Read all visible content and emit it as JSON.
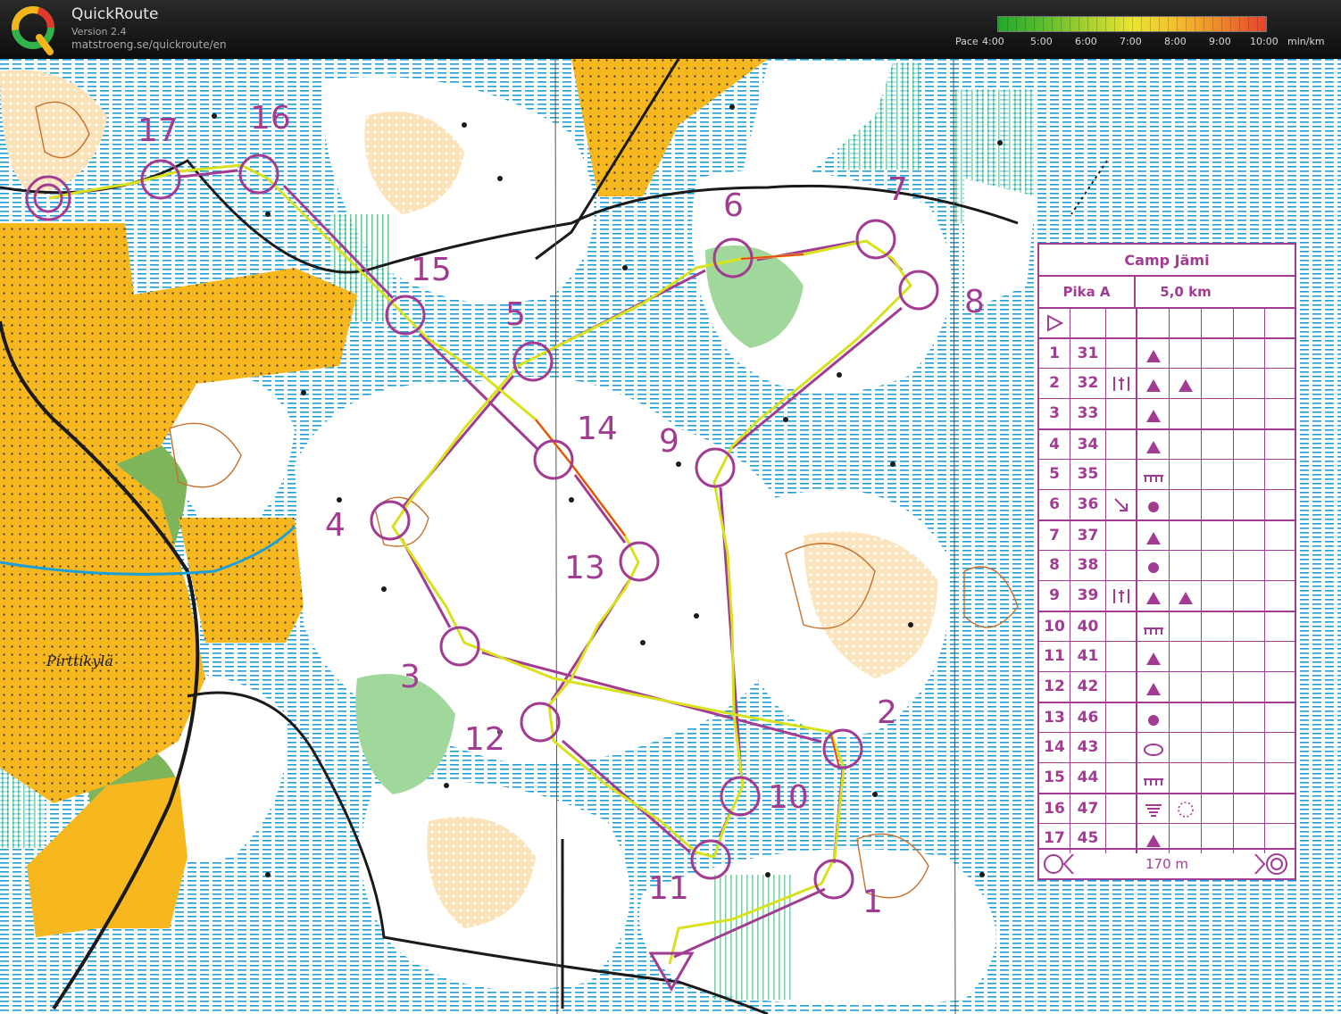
{
  "app": {
    "name": "QuickRoute",
    "version": "Version 2.4",
    "url": "matstroeng.se/quickroute/en"
  },
  "pace_scale": {
    "label": "Pace",
    "ticks": [
      "4:00",
      "5:00",
      "6:00",
      "7:00",
      "8:00",
      "9:00",
      "10:00"
    ],
    "unit": "min/km",
    "colors": [
      "#1faa2a",
      "#e9e52e",
      "#e8422a"
    ]
  },
  "map": {
    "place_name": "Pirttikylä",
    "colors": {
      "open_land": "#f7b71f",
      "marsh_blue": "#1b9fd8",
      "course_purple": "#a23c92",
      "forest_white": "#ffffff",
      "green_veg": "#8fd08a",
      "contour_brown": "#c8702a"
    },
    "controls": [
      {
        "label": "1"
      },
      {
        "label": "2"
      },
      {
        "label": "3"
      },
      {
        "label": "4"
      },
      {
        "label": "5"
      },
      {
        "label": "6"
      },
      {
        "label": "7"
      },
      {
        "label": "8"
      },
      {
        "label": "9"
      },
      {
        "label": "10"
      },
      {
        "label": "11"
      },
      {
        "label": "12"
      },
      {
        "label": "13"
      },
      {
        "label": "14"
      },
      {
        "label": "15"
      },
      {
        "label": "16"
      },
      {
        "label": "17"
      }
    ]
  },
  "description_sheet": {
    "title": "Camp Jämi",
    "class_name": "Pika A",
    "length": "5,0 km",
    "rows": [
      {
        "num": "1",
        "code": "31",
        "feature": "triangle"
      },
      {
        "num": "2",
        "code": "32",
        "feature": "triangle"
      },
      {
        "num": "3",
        "code": "33",
        "feature": "triangle"
      },
      {
        "num": "4",
        "code": "34",
        "feature": "triangle"
      },
      {
        "num": "5",
        "code": "35",
        "feature": "comb"
      },
      {
        "num": "6",
        "code": "36",
        "feature": "dot"
      },
      {
        "num": "7",
        "code": "37",
        "feature": "triangle"
      },
      {
        "num": "8",
        "code": "38",
        "feature": "dot"
      },
      {
        "num": "9",
        "code": "39",
        "feature": "triangle"
      },
      {
        "num": "10",
        "code": "40",
        "feature": "comb"
      },
      {
        "num": "11",
        "code": "41",
        "feature": "triangle"
      },
      {
        "num": "12",
        "code": "42",
        "feature": "triangle"
      },
      {
        "num": "13",
        "code": "46",
        "feature": "dot"
      },
      {
        "num": "14",
        "code": "43",
        "feature": "ellipse"
      },
      {
        "num": "15",
        "code": "44",
        "feature": "comb"
      },
      {
        "num": "16",
        "code": "47",
        "feature": "depression"
      },
      {
        "num": "17",
        "code": "45",
        "feature": "triangle"
      }
    ],
    "finish_distance": "170 m"
  }
}
